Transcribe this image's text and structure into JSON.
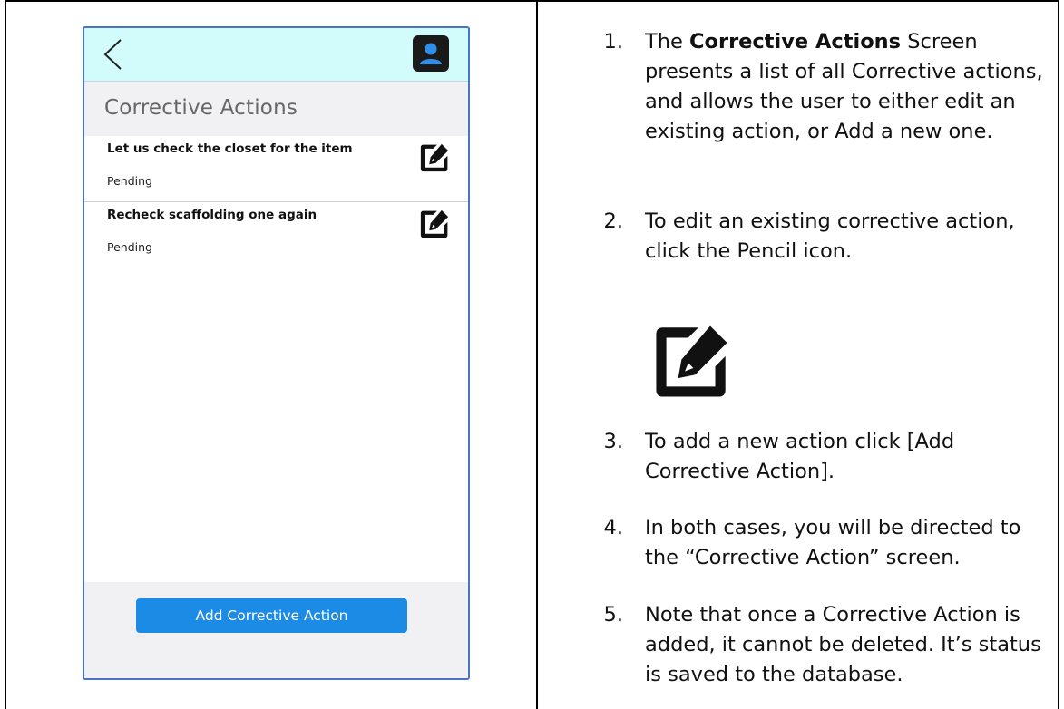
{
  "phone": {
    "section_title": "Corrective Actions",
    "actions": [
      {
        "title": "Let us check the closet for the item",
        "status": "Pending"
      },
      {
        "title": "Recheck scaffolding one again",
        "status": "Pending"
      }
    ],
    "add_button_label": "Add Corrective Action",
    "colors": {
      "header_bg": "#d2fbfb",
      "button_bg": "#1c8be5",
      "section_bg": "#f1f1f3"
    },
    "icons": [
      "back-chevron-icon",
      "profile-icon",
      "edit-pencil-icon"
    ]
  },
  "instructions": {
    "step1": {
      "num": "1.",
      "pre": "The ",
      "bold": "Corrective Actions",
      "post": " Screen presents a list of all Corrective actions, and allows the user to either edit an existing action, or Add a new one."
    },
    "step2": {
      "num": "2.",
      "text": "To edit an existing corrective action, click the Pencil icon."
    },
    "step3": {
      "num": "3.",
      "text": "To add a new action click [Add Corrective Action]."
    },
    "step4": {
      "num": "4.",
      "text": "In both cases, you will be directed to the “Corrective Action” screen."
    },
    "step5": {
      "num": "5.",
      "text": "Note that once a Corrective Action is added, it cannot be deleted. It’s status is saved to the database."
    }
  }
}
